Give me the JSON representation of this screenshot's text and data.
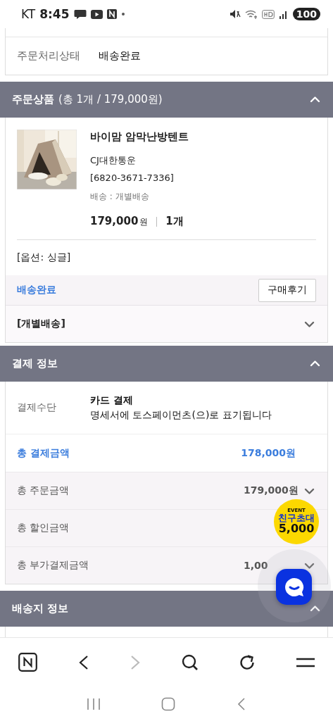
{
  "status_bar": {
    "carrier": "KT",
    "time": "8:45",
    "battery": "100"
  },
  "order_status": {
    "label": "주문처리상태",
    "value": "배송완료"
  },
  "order_items": {
    "title": "주문상품",
    "summary": "(총 1개 / 179,000원)",
    "expanded": true,
    "product": {
      "name": "바이맘 암막난방텐트",
      "courier": "CJ대한통운",
      "tracking": "[6820-3671-7336]",
      "shipping": "배송 : 개별배송",
      "price": "179,000",
      "currency": "원",
      "quantity": "1개",
      "option": "[옵션: 싱글]"
    },
    "delivery_status": "배송완료",
    "review_button": "구매후기",
    "shipping_group": {
      "label": "[개별배송]",
      "expanded": false
    }
  },
  "payment": {
    "title": "결제 정보",
    "expanded": true,
    "method_label": "결제수단",
    "method": "카드 결제",
    "method_note": "명세서에 토스페이먼츠(으)로 표기됩니다",
    "total_label": "총 결제금액",
    "total": "178,000원",
    "rows": [
      {
        "label": "총 주문금액",
        "value": "179,000원",
        "expanded": false
      },
      {
        "label": "총 할인금액"
      },
      {
        "label": "총 부가결제금액",
        "value": "1,00",
        "expanded": false
      }
    ]
  },
  "shipping_address": {
    "title": "배송지 정보",
    "expanded": true
  },
  "event_badge": {
    "tag": "EVENT",
    "title": "친구초대",
    "amount": "5,000"
  },
  "browser_toolbar": {
    "forward_disabled": true
  }
}
